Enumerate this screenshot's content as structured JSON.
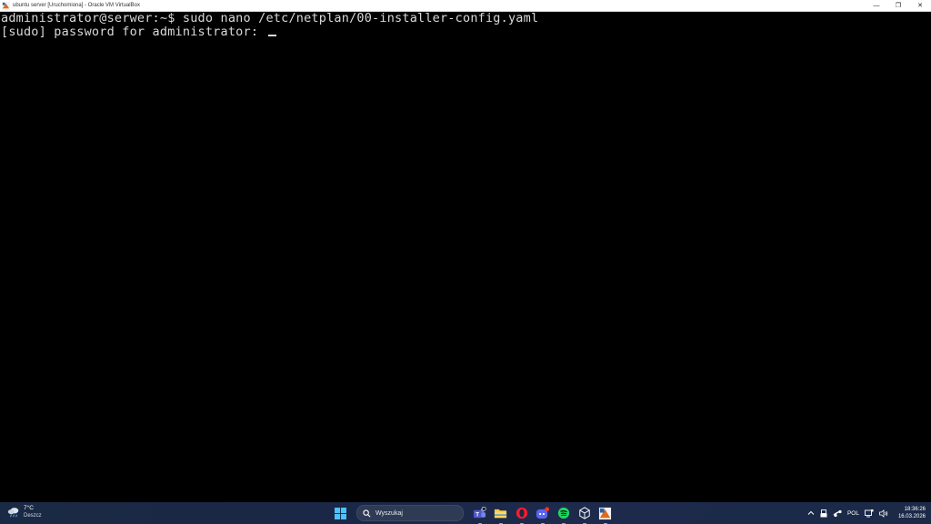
{
  "window": {
    "title": "ubuntu server [Uruchomiona] - Oracle VM VirtualBox",
    "controls": {
      "minimize": "—",
      "restore": "❐",
      "close": "✕"
    }
  },
  "console": {
    "lines": [
      "administrator@serwer:~$ sudo nano /etc/netplan/00-installer-config.yaml",
      "[sudo] password for administrator: "
    ]
  },
  "taskbar": {
    "weather": {
      "temp": "7°C",
      "desc": "Deszcz",
      "icon": "rain-cloud-icon"
    },
    "search_label": "Wyszukaj",
    "apps": [
      {
        "name": "teams-icon",
        "running": true
      },
      {
        "name": "file-explorer-icon",
        "running": true
      },
      {
        "name": "opera-icon",
        "running": true
      },
      {
        "name": "discord-icon",
        "running": true
      },
      {
        "name": "spotify-icon",
        "running": true
      },
      {
        "name": "virtualbox-icon",
        "running": true
      },
      {
        "name": "virtualbox-vm-icon",
        "running": true
      }
    ],
    "tray": {
      "language": "POL",
      "time": "18:36:26",
      "date": "16.03.2026"
    }
  },
  "colors": {
    "console_bg": "#000000",
    "console_fg": "#d9d9d9",
    "taskbar_bg": "#1b2a44"
  }
}
